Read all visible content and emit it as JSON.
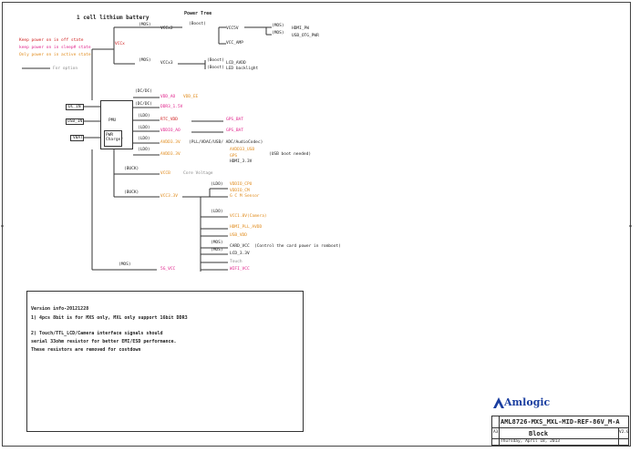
{
  "title": "1 cell lithium battery",
  "power_tree": "Power Tree",
  "legend": {
    "off": "Keep power on in off state",
    "sleep": "keep power on in sleep# state",
    "active": "Only power on in active state",
    "option": "For option"
  },
  "vccx": "VCCx",
  "left_inputs": [
    "DC_IN",
    "USB_IN",
    "VBAT"
  ],
  "pmu": "PMU",
  "charger": "PWR Charger",
  "mos": "(MOS)",
  "boost": "(Boost)",
  "dcdc": "(DC/DC)",
  "ldo": "(LDO)",
  "buck": "(BUCK)",
  "top": {
    "vccx2": "VCCx2",
    "vcc5v": "VCC5V",
    "hdmi_pw": "HDMI_PW",
    "usb_otg_pwr": "USB_OTG_PWR",
    "vcc_amp": "VCC_AMP",
    "vccx3": "VCCx3",
    "lcd_avdd": "LCD_AVDD",
    "led_backlight": "LED backlight"
  },
  "rails": {
    "vdd_ao": "VDD_AO",
    "vdd_ee": "VDD_EE",
    "ddr3": "DDR3_1.5V",
    "rtc_vdd": "RTC_VDD",
    "vddio_ao": "VDDIO_AO",
    "gps_bat1": "GPS_BAT",
    "gps_bat2": "GPS_BAT",
    "avdd3v": "AVDD3.3V",
    "avdd3v_note": "(PLL/VDAC/USB/ ADC/AudioCodec)",
    "avdd33_usb": "AVDD33_USB",
    "gps": "GPS",
    "usb_boot_note": "(USB boot needed)",
    "hdmi_33": "HDMI_3.3V",
    "vccb": "VCCB",
    "core_voltage": "Core Voltage",
    "vcc3_3v": "VCC3.3V",
    "vddio_cpu": "VDDIO_CPU",
    "vddio_cm": "VDDIO_CM",
    "gcm_sensor": "G C M Sensor",
    "vcc18_camera": "VCC1.8V(Camera)",
    "hdmi_pll": "HDMI_PLL_AVDD",
    "usb_vdd": "USB_VDD",
    "card_vcc": "CARD_VCC",
    "card_note": "(Control the card power in romboot)",
    "lcd_33": "LCD_3.3V",
    "touch": "Touch",
    "g5_vcc": "5G_VCC",
    "wifi_vcc": "WIFI_VCC"
  },
  "notes": {
    "line1": "Version info-20121228",
    "line2": "1) 4pcs 8bit is for MXS only, MXL only support 16bit DDR3",
    "line3": "2) Touch/TTL_LCD/Camera interface signals should",
    "line4": "serial 33ohm resistor for better EMI/ESD performance.",
    "line5": "These resistors are removed for costdown"
  },
  "title_block": {
    "logo": "Amlogic",
    "doc_title": "AML8726-MXS_MXL-MID-REF-86V_M-A",
    "sheet": "Block",
    "date": "Thursday, April 18, 2013",
    "size": "A3",
    "rev": "V2.0"
  }
}
